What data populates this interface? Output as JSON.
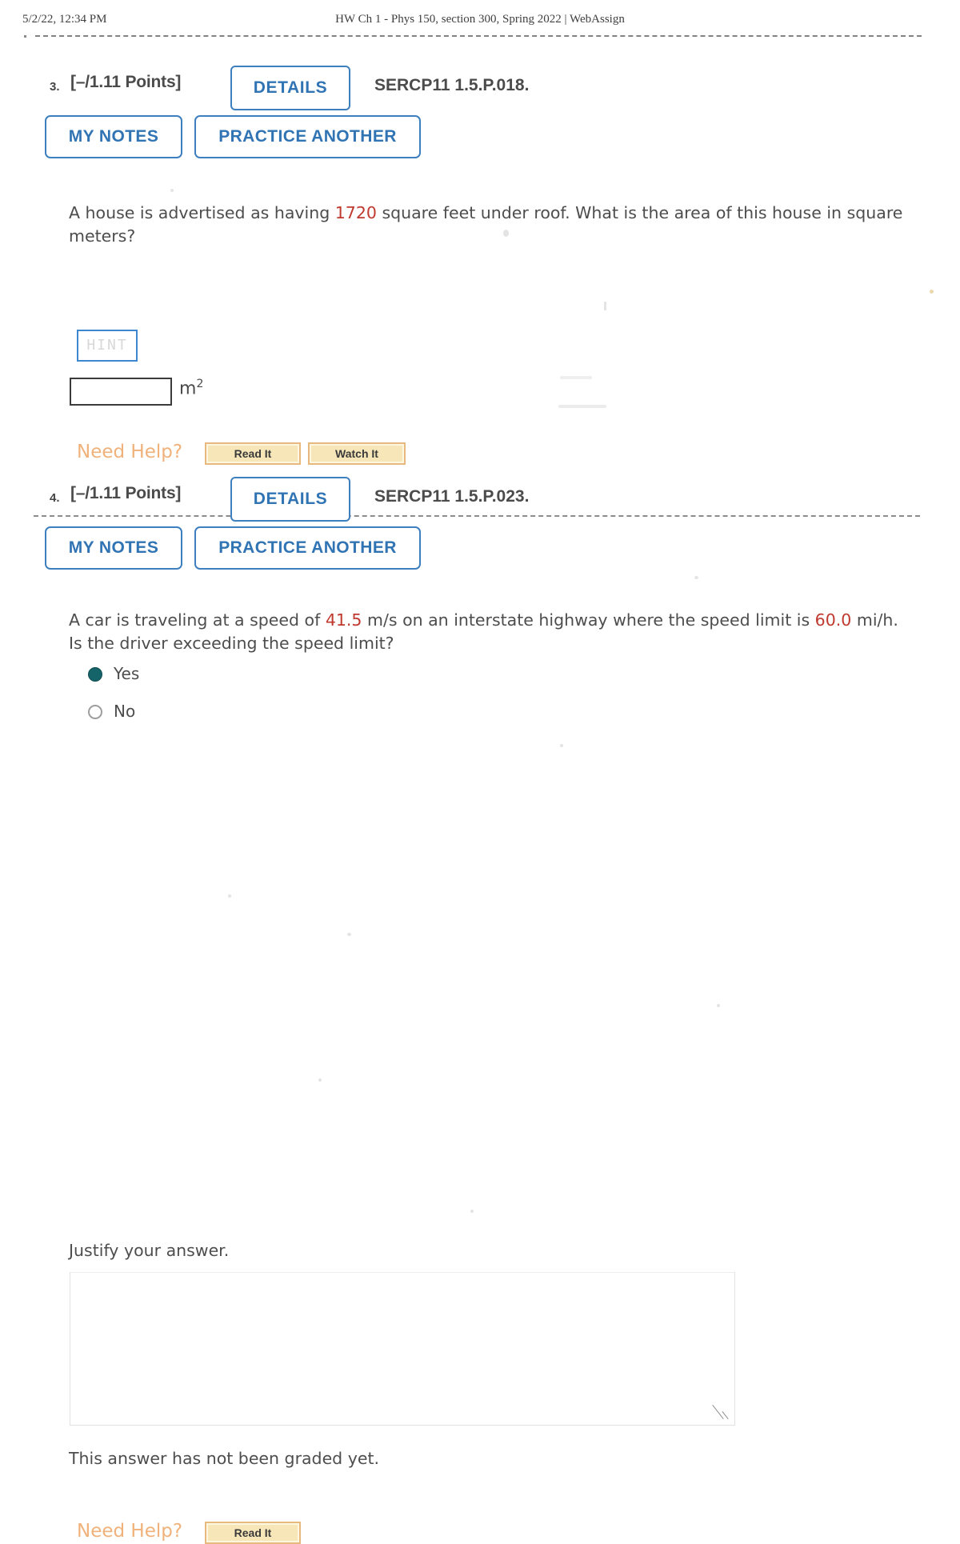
{
  "print_header": {
    "date_time": "5/2/22, 12:34 PM",
    "title": "HW Ch 1 - Phys 150, section 300, Spring 2022 | WebAssign"
  },
  "colors": {
    "link_blue": "#3174b4",
    "border_blue": "#3d7fbf",
    "value_red": "#c0392f",
    "need_help_orange": "#f0b27a",
    "help_button_fill": "#f7e6b8",
    "radio_selected": "#156469"
  },
  "questions": [
    {
      "number": "3.",
      "points": "[–/1.11 Points]",
      "details_label": "DETAILS",
      "code": "SERCP11 1.5.P.018.",
      "my_notes_label": "MY NOTES",
      "practice_label": "PRACTICE ANOTHER",
      "prompt_part1": "A house is advertised as having ",
      "prompt_value1": "1720",
      "prompt_part2": " square feet under roof. What is the area of this house in square meters?",
      "hint_label": "HINT",
      "answer_value": "",
      "answer_unit": "m",
      "answer_unit_exp": "2",
      "need_help_label": "Need Help?",
      "help_buttons": [
        "Read It",
        "Watch It"
      ]
    },
    {
      "number": "4.",
      "points": "[–/1.11 Points]",
      "details_label": "DETAILS",
      "code": "SERCP11 1.5.P.023.",
      "my_notes_label": "MY NOTES",
      "practice_label": "PRACTICE ANOTHER",
      "prompt_part1": "A car is traveling at a speed of ",
      "prompt_value1": "41.5",
      "prompt_part2": " m/s on an interstate highway where the speed limit is ",
      "prompt_value2": "60.0",
      "prompt_part3": " mi/h. Is the driver exceeding the speed limit?",
      "options": [
        {
          "label": "Yes",
          "selected": true
        },
        {
          "label": "No",
          "selected": false
        }
      ],
      "justify_label": "Justify your answer.",
      "justify_value": "",
      "grading_status": "This answer has not been graded yet.",
      "need_help_label": "Need Help?",
      "help_buttons": [
        "Read It"
      ]
    }
  ]
}
